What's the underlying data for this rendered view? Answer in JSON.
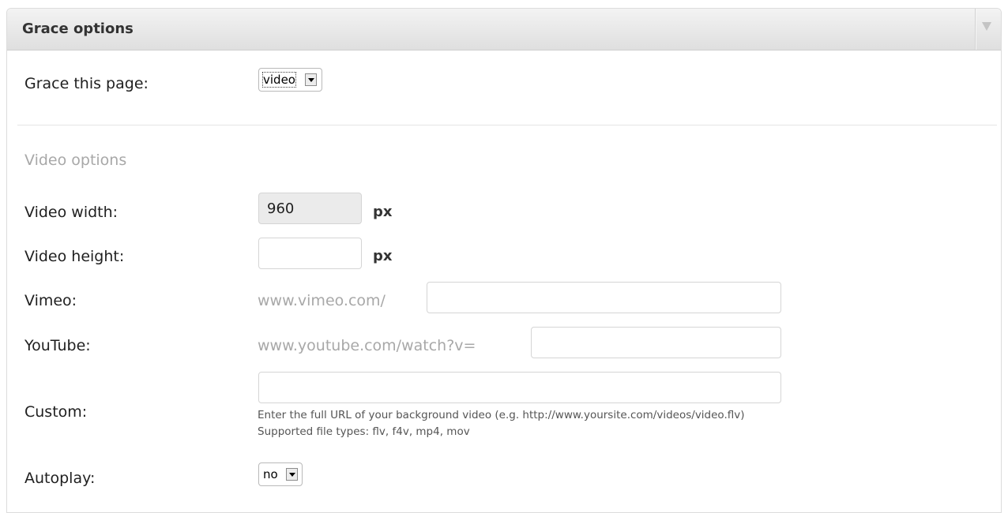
{
  "panel": {
    "title": "Grace options"
  },
  "grace": {
    "label": "Grace this page:",
    "selected": "video"
  },
  "video_options": {
    "section_title": "Video options",
    "width": {
      "label": "Video width:",
      "value": "960",
      "unit": "px"
    },
    "height": {
      "label": "Video height:",
      "value": "",
      "unit": "px"
    },
    "vimeo": {
      "label": "Vimeo:",
      "prefix": "www.vimeo.com/",
      "value": ""
    },
    "youtube": {
      "label": "YouTube:",
      "prefix": "www.youtube.com/watch?v=",
      "value": ""
    },
    "custom": {
      "label": "Custom:",
      "value": "",
      "help_line1": "Enter the full URL of your background video (e.g. http://www.yoursite.com/videos/video.flv)",
      "help_line2": "Supported file types: flv, f4v, mp4, mov"
    },
    "autoplay": {
      "label": "Autoplay:",
      "selected": "no"
    }
  },
  "icons": {
    "toggle": "triangle-down-icon",
    "select_arrow": "chevron-down-icon"
  },
  "colors": {
    "header_bg": "#e6e6e6",
    "section_title": "#a8a8a8",
    "disabled_input_bg": "#ebebeb"
  }
}
